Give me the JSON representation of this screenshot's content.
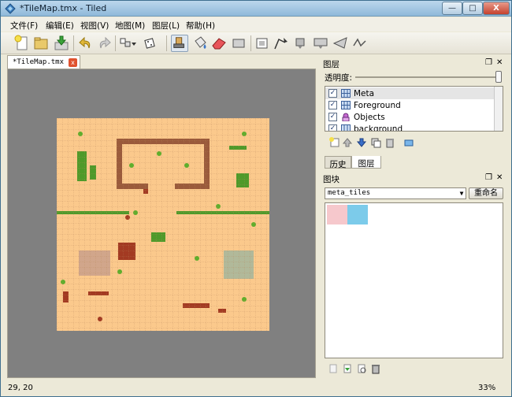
{
  "window": {
    "title": "*TileMap.tmx - Tiled",
    "minimize_label": "—",
    "maximize_label": "□",
    "close_label": "X"
  },
  "menu": [
    {
      "label": "文件(F)"
    },
    {
      "label": "编辑(E)"
    },
    {
      "label": "视图(V)"
    },
    {
      "label": "地图(M)"
    },
    {
      "label": "图层(L)"
    },
    {
      "label": "帮助(H)"
    }
  ],
  "toolbar": {
    "icons": [
      "new-icon",
      "open-icon",
      "save-icon",
      "undo-icon",
      "redo-icon",
      "stamp-dropdown-icon",
      "random-icon",
      "stamp-brush-icon",
      "bucket-fill-icon",
      "eraser-icon",
      "rectangle-select-icon",
      "move-objects-icon",
      "edit-polygon-icon",
      "insert-object-icon",
      "insert-tile-icon",
      "insert-polygon-icon",
      "insert-polyline-icon"
    ]
  },
  "document": {
    "tab_label": "*TileMap.tmx",
    "close_label": "x"
  },
  "layers_panel": {
    "title": "图层",
    "opacity_label": "透明度:",
    "opacity": 1.0,
    "layers": [
      {
        "name": "Meta",
        "visible": true,
        "icon": "tile-layer-icon",
        "selected": true
      },
      {
        "name": "Foreground",
        "visible": true,
        "icon": "tile-layer-icon",
        "selected": false
      },
      {
        "name": "Objects",
        "visible": true,
        "icon": "object-layer-icon",
        "selected": false
      },
      {
        "name": "background",
        "visible": true,
        "icon": "tile-layer-icon",
        "selected": false
      }
    ],
    "tabs": [
      {
        "label": "历史"
      },
      {
        "label": "图层"
      }
    ]
  },
  "tilesets_panel": {
    "title": "图块",
    "selected_tileset": "meta_tiles",
    "rename_label": "重命名",
    "tiles": [
      {
        "color": "#f6c8cc"
      },
      {
        "color": "#7ccbea"
      }
    ]
  },
  "status": {
    "coords": "29, 20",
    "zoom": "33%"
  },
  "colors": {
    "map_ground": "#fbc98c",
    "map_wall": "#9a5a3b",
    "bush": "#4e9a2a",
    "rock": "#a33a22",
    "paving": "#c9a08b",
    "water_grass": "#a8b79b"
  }
}
